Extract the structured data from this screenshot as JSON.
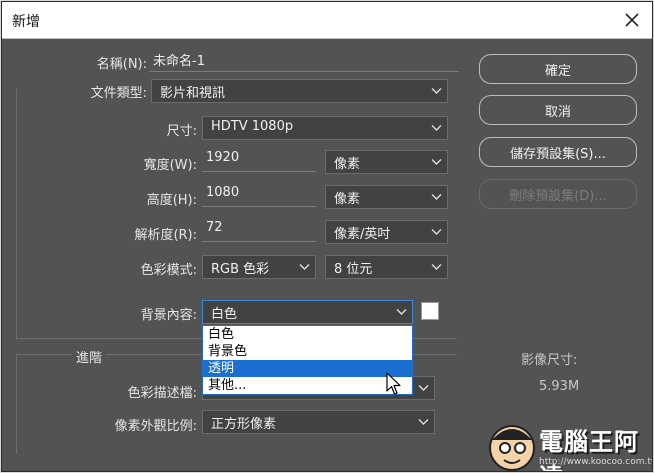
{
  "window": {
    "title": "新增"
  },
  "form": {
    "name_label": "名稱(N):",
    "name_value": "未命名-1",
    "doc_type_label": "文件類型:",
    "doc_type_value": "影片和視訊",
    "size_label": "尺寸:",
    "size_value": "HDTV 1080p",
    "width_label": "寬度(W):",
    "width_value": "1920",
    "width_unit": "像素",
    "height_label": "高度(H):",
    "height_value": "1080",
    "height_unit": "像素",
    "resolution_label": "解析度(R):",
    "resolution_value": "72",
    "resolution_unit": "像素/英吋",
    "color_mode_label": "色彩模式:",
    "color_mode_value": "RGB 色彩",
    "bit_depth_value": "8 位元",
    "background_label": "背景內容:",
    "background_value": "白色",
    "background_options": [
      "白色",
      "背景色",
      "透明",
      "其他..."
    ],
    "background_highlighted_index": 2
  },
  "advanced": {
    "title": "進階",
    "profile_label": "色彩描述檔:",
    "pixel_aspect_label": "像素外觀比例:",
    "pixel_aspect_value": "正方形像素"
  },
  "buttons": {
    "ok": "確定",
    "cancel": "取消",
    "save_preset": "儲存預設集(S)...",
    "delete_preset": "刪除預設集(D)..."
  },
  "image_size": {
    "label": "影像尺寸:",
    "value": "5.93M"
  },
  "watermark": {
    "text": "電腦王阿達",
    "url": "http://www.koocoo.com.tw"
  }
}
